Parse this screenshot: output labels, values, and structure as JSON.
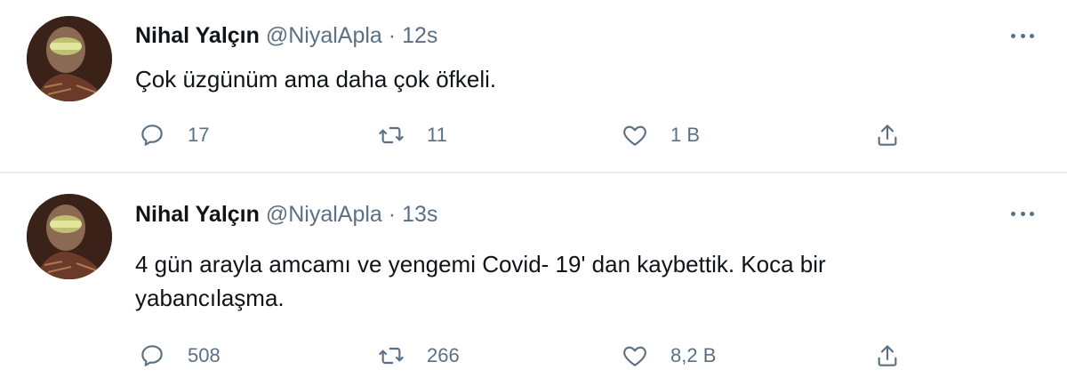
{
  "tweets": [
    {
      "author_name": "Nihal Yalçın",
      "handle": "@NiyalApla",
      "separator": "·",
      "time": "12s",
      "text": "Çok üzgünüm ama daha çok öfkeli.",
      "replies": "17",
      "retweets": "11",
      "likes": "1 B"
    },
    {
      "author_name": "Nihal Yalçın",
      "handle": "@NiyalApla",
      "separator": "·",
      "time": "13s",
      "text": "4 gün arayla amcamı ve yengemi Covid- 19' dan kaybettik. Koca bir yabancılaşma.",
      "replies": "508",
      "retweets": "266",
      "likes": "8,2 B"
    }
  ],
  "icons": {
    "reply": "reply-icon",
    "retweet": "retweet-icon",
    "like": "heart-icon",
    "share": "share-icon",
    "more": "more-options-icon"
  },
  "colors": {
    "name": "#0f1419",
    "secondary": "#5b7083",
    "divider": "#e6ecf0"
  }
}
